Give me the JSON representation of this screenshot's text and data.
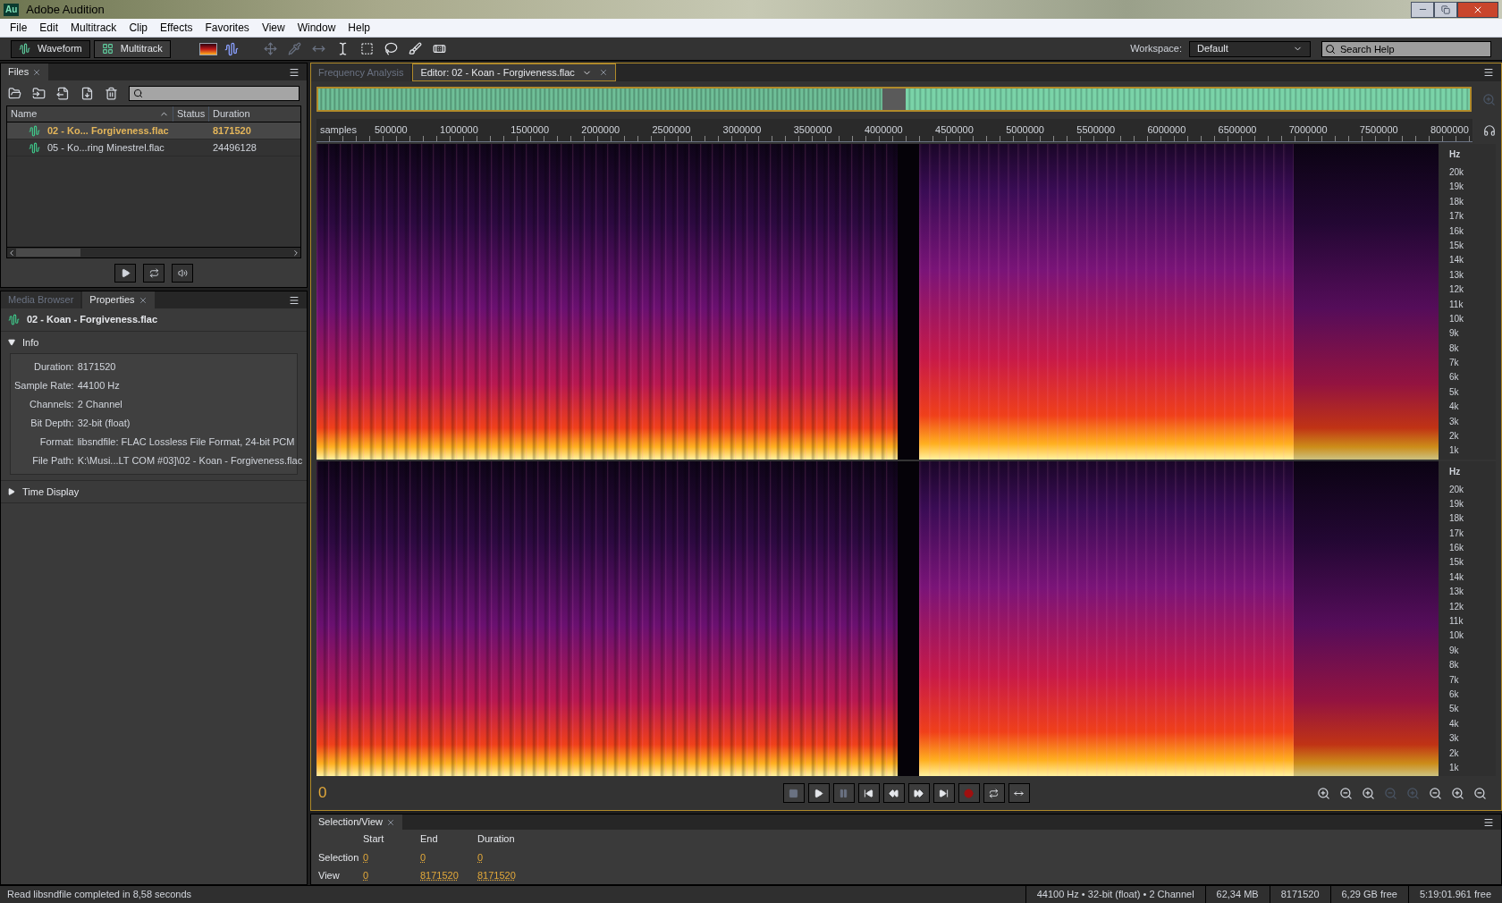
{
  "window": {
    "badge": "Au",
    "title": "Adobe Audition"
  },
  "menu": [
    "File",
    "Edit",
    "Multitrack",
    "Clip",
    "Effects",
    "Favorites",
    "View",
    "Window",
    "Help"
  ],
  "toolbar": {
    "modes": [
      {
        "label": "Waveform",
        "selected": true
      },
      {
        "label": "Multitrack",
        "selected": false
      }
    ],
    "workspace_label": "Workspace:",
    "workspace": "Default",
    "search_placeholder": "Search Help"
  },
  "files_panel": {
    "tab": "Files",
    "columns": [
      "Name",
      "Status",
      "Duration"
    ],
    "rows": [
      {
        "name": "02 - Ko... Forgiveness.flac",
        "duration": "8171520",
        "selected": true
      },
      {
        "name": "05 - Ko...ring Minestrel.flac",
        "duration": "24496128",
        "selected": false
      }
    ]
  },
  "lower_tabs": [
    {
      "label": "Media Browser",
      "selected": false
    },
    {
      "label": "Properties",
      "selected": true
    }
  ],
  "properties": {
    "file": "02 - Koan - Forgiveness.flac",
    "sections": [
      {
        "title": "Info",
        "expanded": true,
        "fields": [
          {
            "label": "Duration:",
            "value": "8171520"
          },
          {
            "label": "Sample Rate:",
            "value": "44100 Hz"
          },
          {
            "label": "Channels:",
            "value": "2 Channel"
          },
          {
            "label": "Bit Depth:",
            "value": "32-bit (float)"
          },
          {
            "label": "Format:",
            "value": "libsndfile: FLAC Lossless File Format, 24-bit PCM"
          },
          {
            "label": "File Path:",
            "value": "K:\\Musi...LT COM #03]\\02 - Koan - Forgiveness.flac"
          }
        ]
      },
      {
        "title": "Time Display",
        "expanded": false
      }
    ]
  },
  "editor_tabs": [
    {
      "label": "Frequency Analysis",
      "selected": false
    },
    {
      "label": "Editor: 02 - Koan - Forgiveness.flac",
      "selected": true
    }
  ],
  "ruler": {
    "unit": "samples",
    "labels": [
      "500000",
      "1000000",
      "1500000",
      "2000000",
      "2500000",
      "3000000",
      "3500000",
      "4000000",
      "4500000",
      "5000000",
      "5500000",
      "6000000",
      "6500000",
      "7000000",
      "7500000",
      "8000000"
    ]
  },
  "frequency_axes": [
    {
      "unit": "Hz",
      "labels": [
        "20k",
        "19k",
        "18k",
        "17k",
        "16k",
        "15k",
        "14k",
        "13k",
        "12k",
        "11k",
        "10k",
        "9k",
        "8k",
        "7k",
        "6k",
        "5k",
        "4k",
        "3k",
        "2k",
        "1k"
      ]
    },
    {
      "unit": "Hz",
      "labels": [
        "20k",
        "19k",
        "18k",
        "17k",
        "16k",
        "15k",
        "14k",
        "13k",
        "12k",
        "11k",
        "10k",
        "9k",
        "8k",
        "7k",
        "6k",
        "5k",
        "4k",
        "3k",
        "2k",
        "1k"
      ]
    }
  ],
  "time_display": "0",
  "selection_view": {
    "tab": "Selection/View",
    "columns": [
      "Start",
      "End",
      "Duration"
    ],
    "rows": [
      {
        "label": "Selection",
        "values": [
          "0",
          "0",
          "0"
        ]
      },
      {
        "label": "View",
        "values": [
          "0",
          "8171520",
          "8171520"
        ]
      }
    ]
  },
  "status_bar": {
    "message": "Read libsndfile completed in 8,58 seconds",
    "fields": [
      "44100 Hz • 32-bit (float) • 2 Channel",
      "62,34 MB",
      "8171520",
      "6,29 GB free",
      "5:19:01.961 free"
    ]
  }
}
